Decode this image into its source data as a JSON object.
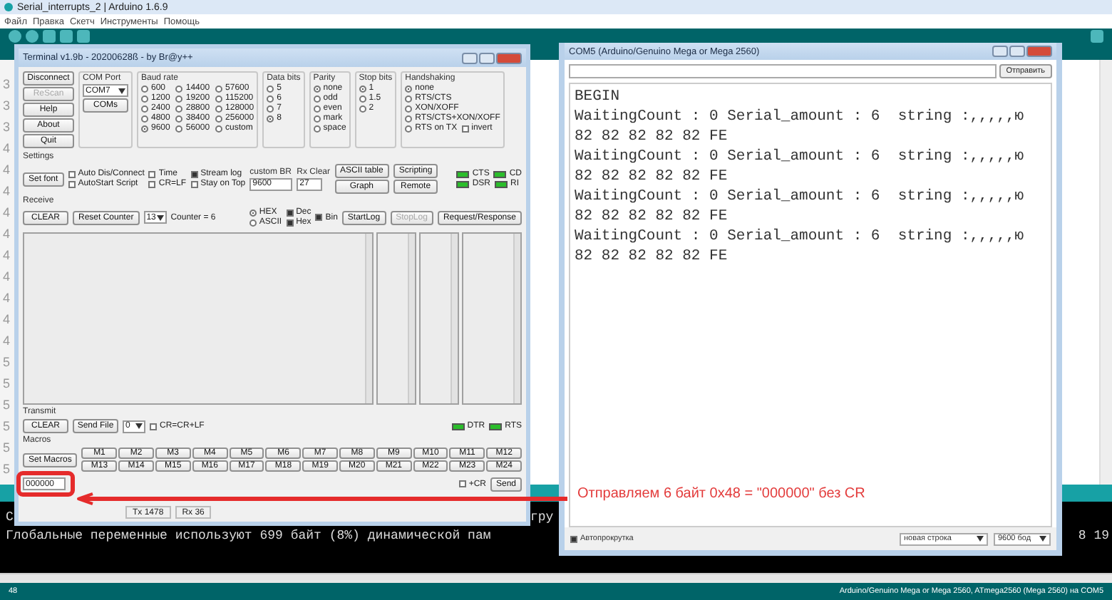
{
  "ide": {
    "title": "Serial_interrupts_2 | Arduino 1.6.9",
    "menu": [
      "Файл",
      "Правка",
      "Скетч",
      "Инструменты",
      "Помощь"
    ],
    "line_numbers": [
      "3",
      "3",
      "3",
      "4",
      "4",
      "4",
      "4",
      "4",
      "4",
      "4",
      "4",
      "4",
      "4",
      "5",
      "5",
      "5",
      "5",
      "5",
      "5"
    ],
    "console": [
      {
        "segments": [
          "С",
          "гру"
        ]
      },
      {
        "segments": [
          "Глобальные переменные используют 699 байт (8%) динамической пам",
          "8 19"
        ]
      }
    ],
    "status_line": "48",
    "board": "Arduino/Genuino Mega or Mega 2560, ATmega2560 (Mega 2560) на COM5"
  },
  "terminal": {
    "title": "Terminal v1.9b - 20200628ß - by Br@y++",
    "side_buttons": [
      {
        "label": "Disconnect",
        "disabled": false
      },
      {
        "label": "ReScan",
        "disabled": true
      },
      {
        "label": "Help",
        "disabled": false
      },
      {
        "label": "About",
        "disabled": false
      },
      {
        "label": "Quit",
        "disabled": false
      }
    ],
    "com_port": {
      "label": "COM Port",
      "value": "COM7",
      "button": "COMs"
    },
    "baud_rate": {
      "label": "Baud rate",
      "options": [
        {
          "label": "600",
          "selected": false
        },
        {
          "label": "1200",
          "selected": false
        },
        {
          "label": "2400",
          "selected": false
        },
        {
          "label": "4800",
          "selected": false
        },
        {
          "label": "9600",
          "selected": true
        },
        {
          "label": "14400",
          "selected": false
        },
        {
          "label": "19200",
          "selected": false
        },
        {
          "label": "28800",
          "selected": false
        },
        {
          "label": "38400",
          "selected": false
        },
        {
          "label": "56000",
          "selected": false
        },
        {
          "label": "57600",
          "selected": false
        },
        {
          "label": "115200",
          "selected": false
        },
        {
          "label": "128000",
          "selected": false
        },
        {
          "label": "256000",
          "selected": false
        },
        {
          "label": "custom",
          "selected": false
        }
      ]
    },
    "data_bits": {
      "label": "Data bits",
      "options": [
        {
          "label": "5",
          "selected": false
        },
        {
          "label": "6",
          "selected": false
        },
        {
          "label": "7",
          "selected": false
        },
        {
          "label": "8",
          "selected": true
        }
      ]
    },
    "parity": {
      "label": "Parity",
      "options": [
        {
          "label": "none",
          "selected": true
        },
        {
          "label": "odd",
          "selected": false
        },
        {
          "label": "even",
          "selected": false
        },
        {
          "label": "mark",
          "selected": false
        },
        {
          "label": "space",
          "selected": false
        }
      ]
    },
    "stop_bits": {
      "label": "Stop bits",
      "options": [
        {
          "label": "1",
          "selected": true
        },
        {
          "label": "1.5",
          "selected": false
        },
        {
          "label": "2",
          "selected": false
        }
      ]
    },
    "handshaking": {
      "label": "Handshaking",
      "options": [
        {
          "label": "none",
          "selected": true
        },
        {
          "label": "RTS/CTS",
          "selected": false
        },
        {
          "label": "XON/XOFF",
          "selected": false
        },
        {
          "label": "RTS/CTS+XON/XOFF",
          "selected": false
        },
        {
          "label": "RTS on TX",
          "selected": false
        }
      ],
      "invert": {
        "label": "invert",
        "checked": false
      }
    },
    "settings": {
      "label": "Settings",
      "font_button": "Set font",
      "checks": [
        {
          "label": "Auto Dis/Connect",
          "checked": false
        },
        {
          "label": "AutoStart Script",
          "checked": false
        },
        {
          "label": "Time",
          "checked": false
        },
        {
          "label": "CR=LF",
          "checked": false
        },
        {
          "label": "Stream log",
          "checked": true
        },
        {
          "label": "Stay on Top",
          "checked": false
        }
      ],
      "custom_br": {
        "label": "custom BR",
        "value": "9600"
      },
      "rx_clear": {
        "label": "Rx Clear",
        "value": "27"
      },
      "buttons": [
        "ASCII table",
        "Graph",
        "Scripting",
        "Remote"
      ],
      "leds": [
        "CTS",
        "CD",
        "DSR",
        "RI"
      ]
    },
    "receive": {
      "label": "Receive",
      "clear": "CLEAR",
      "reset": "Reset Counter",
      "spin": "13",
      "counter": "Counter = 6",
      "modes": [
        {
          "label": "HEX",
          "selected": true
        },
        {
          "label": "ASCII",
          "selected": false
        }
      ],
      "checks": [
        {
          "label": "Dec",
          "checked": true
        },
        {
          "label": "Hex",
          "checked": true
        },
        {
          "label": "Bin",
          "checked": true
        }
      ],
      "buttons": [
        {
          "label": "StartLog",
          "disabled": false
        },
        {
          "label": "StopLog",
          "disabled": true
        },
        {
          "label": "Request/Response",
          "disabled": false
        }
      ]
    },
    "transmit": {
      "label": "Transmit",
      "clear": "CLEAR",
      "send_file": "Send File",
      "spin": "0",
      "crlf": {
        "label": "CR=CR+LF",
        "checked": false
      },
      "leds": [
        "DTR",
        "RTS"
      ]
    },
    "macros": {
      "label": "Macros",
      "set_button": "Set Macros",
      "buttons": [
        "M1",
        "M2",
        "M3",
        "M4",
        "M5",
        "M6",
        "M7",
        "M8",
        "M9",
        "M10",
        "M11",
        "M12",
        "M13",
        "M14",
        "M15",
        "M16",
        "M17",
        "M18",
        "M19",
        "M20",
        "M21",
        "M22",
        "M23",
        "M24"
      ]
    },
    "input": {
      "value": "000000",
      "cr": {
        "label": "+CR",
        "checked": false
      },
      "send": "Send"
    },
    "status": [
      "Tx 1478",
      "Rx 36"
    ]
  },
  "serial_monitor": {
    "title": "COM5 (Arduino/Genuino Mega or Mega 2560)",
    "send": "Отправить",
    "lines": [
      "BEGIN",
      "WaitingCount : 0 Serial_amount : 6  string :,,,,,ю",
      "82 82 82 82 82 FE",
      "WaitingCount : 0 Serial_amount : 6  string :,,,,,ю",
      "82 82 82 82 82 FE",
      "WaitingCount : 0 Serial_amount : 6  string :,,,,,ю",
      "82 82 82 82 82 FE",
      "WaitingCount : 0 Serial_amount : 6  string :,,,,,ю",
      "82 82 82 82 82 FE"
    ],
    "autoscroll": {
      "label": "Автопрокрутка",
      "checked": true
    },
    "line_ending": "новая строка",
    "baud": "9600 бод"
  },
  "annotation": {
    "text": "Отправляем 6 байт 0x48 = \"000000\" без CR"
  }
}
